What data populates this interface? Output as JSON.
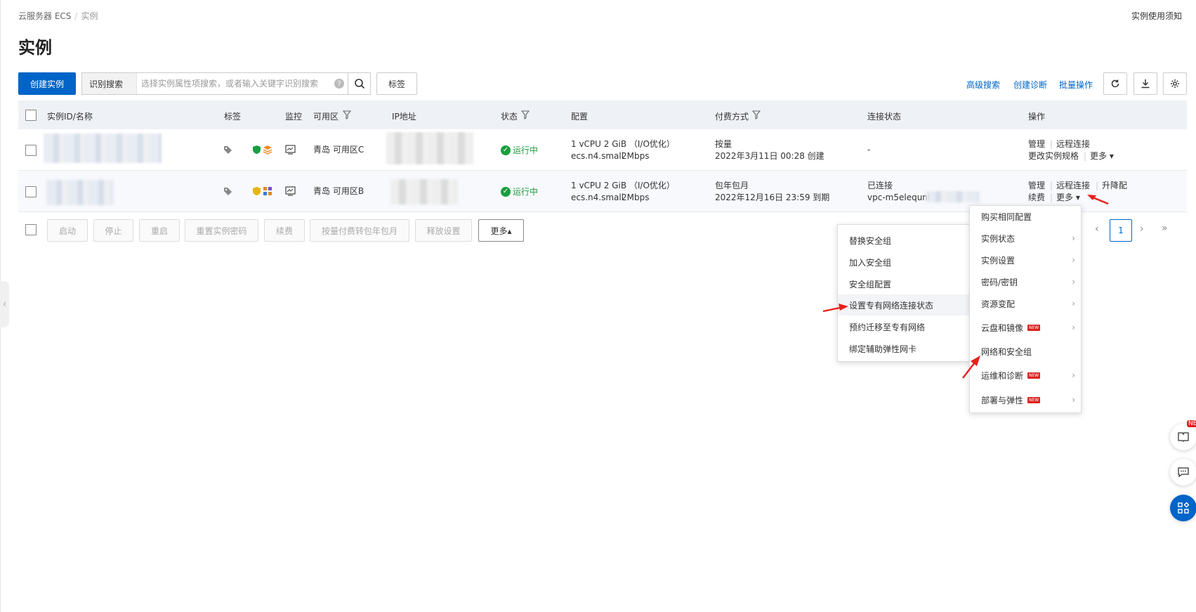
{
  "breadcrumb": {
    "root": "云服务器 ECS",
    "separator": "/",
    "current": "实例"
  },
  "notice_link": "实例使用须知",
  "page_title": "实例",
  "toolbar": {
    "create_label": "创建实例",
    "search_tag": "识别搜索",
    "search_placeholder": "选择实例属性项搜索，或者输入关键字识别搜索",
    "help_glyph": "?",
    "tag_label": "标签",
    "advanced_search": "高级搜索",
    "create_diagnosis": "创建诊断",
    "batch_ops": "批量操作"
  },
  "columns": {
    "id_name": "实例ID/名称",
    "tags": "标签",
    "monitor": "监控",
    "zone": "可用区",
    "ip": "IP地址",
    "status": "状态",
    "config": "配置",
    "billing": "付费方式",
    "connection": "连接状态",
    "actions": "操作"
  },
  "rows": [
    {
      "zone": "青岛 可用区C",
      "status": "运行中",
      "config_line1": "1 vCPU 2 GiB （I/O优化）",
      "config_type": "ecs.n4.small",
      "config_bw": "2Mbps",
      "billing_line1": "按量",
      "billing_line2": "2022年3月11日 00:28 创建",
      "connection_line1": "-",
      "actions": {
        "manage": "管理",
        "remote": "远程连接",
        "resize": "更改实例规格",
        "more": "更多"
      }
    },
    {
      "zone": "青岛 可用区B",
      "status": "运行中",
      "config_line1": "1 vCPU 2 GiB （I/O优化）",
      "config_type": "ecs.n4.small",
      "config_bw": "2Mbps",
      "billing_line1": "包年包月",
      "billing_line2": "2022年12月16日 23:59 到期",
      "connection_line1": "已连接",
      "connection_line2": "vpc-m5elequnl",
      "actions": {
        "manage": "管理",
        "remote": "远程连接",
        "upgrade": "升降配",
        "renew": "续费",
        "more": "更多"
      }
    }
  ],
  "bulk_actions": [
    "启动",
    "停止",
    "重启",
    "重置实例密码",
    "续费",
    "按量付费转包年包月",
    "释放设置"
  ],
  "bulk_more": "更多▴",
  "pagination": {
    "prev": "‹",
    "current": "1",
    "next": "›",
    "last": "»"
  },
  "more_menu": [
    {
      "label": "购买相同配置",
      "submenu": false,
      "new": false
    },
    {
      "label": "实例状态",
      "submenu": true,
      "new": false
    },
    {
      "label": "实例设置",
      "submenu": true,
      "new": false
    },
    {
      "label": "密码/密钥",
      "submenu": true,
      "new": false
    },
    {
      "label": "资源变配",
      "submenu": true,
      "new": false
    },
    {
      "label": "云盘和镜像",
      "submenu": true,
      "new": true
    },
    {
      "label": "网络和安全组",
      "submenu": false,
      "new": false
    },
    {
      "label": "运维和诊断",
      "submenu": true,
      "new": true
    },
    {
      "label": "部署与弹性",
      "submenu": true,
      "new": true
    }
  ],
  "network_submenu": [
    "替换安全组",
    "加入安全组",
    "安全组配置",
    "设置专有网络连接状态",
    "预约迁移至专有网络",
    "绑定辅助弹性网卡"
  ],
  "new_badge": "NEW",
  "chevron": "›",
  "side_handle": "‹",
  "float_badge": "NE",
  "colors": {
    "primary": "#0064c8",
    "running": "#1b9e3e",
    "arrow": "#e8201c",
    "new_badge": "#e02020"
  }
}
